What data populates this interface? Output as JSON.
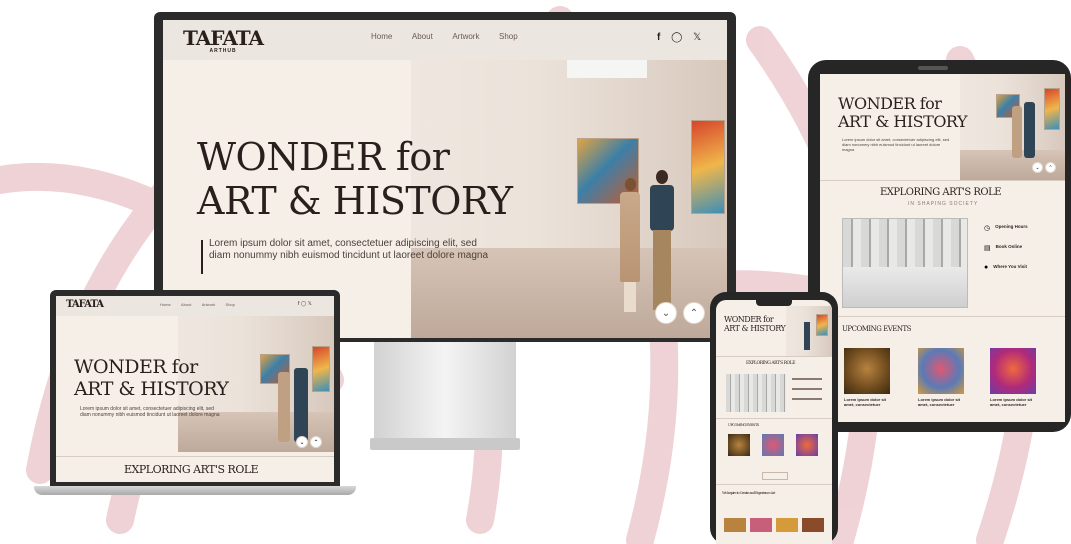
{
  "brand": {
    "logo": "TAFATA",
    "tagline": "ARTHUB",
    "accent": "#c8919b",
    "watermark_color": "#e9c1c8"
  },
  "nav": {
    "items": [
      "Home",
      "About",
      "Artwork",
      "Shop"
    ],
    "social_icons": [
      "facebook-icon",
      "instagram-icon",
      "x-icon"
    ]
  },
  "hero": {
    "title_line1": "WONDER for",
    "title_line2": "ART & HISTORY",
    "body": "Lorem ipsum dolor sit amet, consectetuer adipiscing elit, sed diam nonummy nibh euismod tincidunt ut laoreet dolore magna",
    "controls": [
      "chevron-down-icon",
      "chevron-up-icon"
    ]
  },
  "section_role": {
    "title": "EXPLORING ART'S ROLE",
    "subtitle": "IN SHAPING SOCIETY"
  },
  "info_items": [
    {
      "label": "Opening Hours",
      "icon": "clock-icon"
    },
    {
      "label": "Book Online",
      "icon": "ticket-icon"
    },
    {
      "label": "Where You Visit",
      "icon": "location-icon"
    }
  ],
  "events": {
    "title": "UPCOMING EVENTS",
    "items": [
      {
        "title": "Lorem ipsum dolor sit amet, consectetuer"
      },
      {
        "title": "Lorem ipsum dolor sit amet, consectetuer"
      },
      {
        "title": "Lorem ipsum dolor sit amet, consectetuer"
      }
    ]
  },
  "phone": {
    "promo": "We Inspire to Create and Experience Art"
  }
}
